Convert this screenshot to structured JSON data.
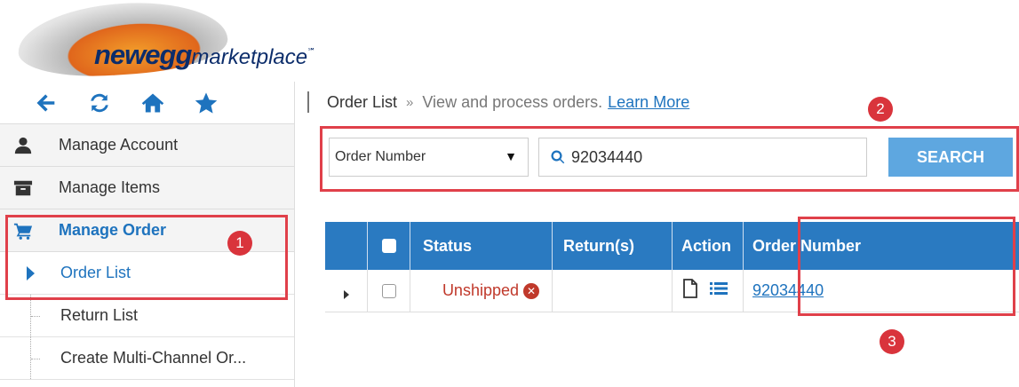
{
  "logo": {
    "brand": "newegg",
    "suffix": "marketplace",
    "mark": "℠"
  },
  "toolbar": {
    "icons": [
      "arrow-left-icon",
      "refresh-icon",
      "home-icon",
      "star-icon"
    ]
  },
  "sidebar": {
    "items": [
      {
        "label": "Manage Account",
        "icon": "user-icon"
      },
      {
        "label": "Manage Items",
        "icon": "archive-box-icon"
      },
      {
        "label": "Manage Order",
        "icon": "cart-icon"
      }
    ],
    "sub_items": [
      {
        "label": "Order List"
      },
      {
        "label": "Return List"
      },
      {
        "label": "Create Multi-Channel Or..."
      }
    ]
  },
  "breadcrumb": {
    "title": "Order List",
    "separator": "»",
    "description": "View and process orders.",
    "link": "Learn More"
  },
  "search": {
    "field_type": "Order Number",
    "value": "92034440",
    "button_label": "SEARCH"
  },
  "table": {
    "columns": [
      "Status",
      "Return(s)",
      "Action",
      "Order Number"
    ],
    "rows": [
      {
        "status": "Unshipped",
        "returns": "",
        "order_number": "92034440"
      }
    ]
  },
  "annotations": [
    "1",
    "2",
    "3"
  ],
  "colors": {
    "accent": "#1e73be",
    "header": "#2a7ac1",
    "button": "#5ea7e0",
    "highlight": "#e0404a",
    "status_unshipped": "#c0392b"
  }
}
